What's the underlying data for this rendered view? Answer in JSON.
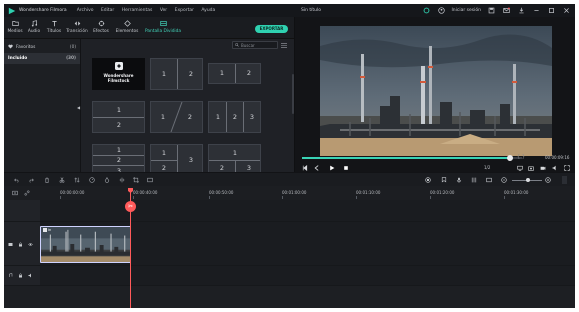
{
  "titlebar": {
    "app_name": "Wondershare Filmora",
    "menu": [
      "Archivo",
      "Editar",
      "Herramientas",
      "Ver",
      "Exportar",
      "Ayuda"
    ],
    "project_name": "Sin título",
    "login": "Iniciar sesión"
  },
  "toolbar": {
    "tabs": [
      {
        "label": "Medios",
        "icon": "folder-icon"
      },
      {
        "label": "Audio",
        "icon": "music-icon"
      },
      {
        "label": "Títulos",
        "icon": "text-icon"
      },
      {
        "label": "Transición",
        "icon": "transition-icon"
      },
      {
        "label": "Efectos",
        "icon": "effects-icon"
      },
      {
        "label": "Elementos",
        "icon": "elements-icon"
      },
      {
        "label": "Pantalla Dividida",
        "icon": "split-screen-icon",
        "active": true
      }
    ],
    "export_label": "EXPORTAR"
  },
  "library": {
    "items": [
      {
        "label": "Favoritos",
        "count": "(0)"
      },
      {
        "label": "Incluido",
        "count": "(30)",
        "selected": true
      }
    ]
  },
  "media": {
    "search_placeholder": "Buscar",
    "stock": {
      "line1": "Wondershare",
      "line2": "Filmstock"
    },
    "tiles": [
      {
        "numbers": [
          "1",
          "2"
        ]
      },
      {
        "numbers": [
          "1",
          "2"
        ]
      },
      {
        "numbers": [
          "1",
          "2"
        ]
      },
      {
        "numbers": [
          "1",
          "2"
        ]
      },
      {
        "numbers": [
          "1",
          "2",
          "3"
        ]
      },
      {
        "numbers": [
          "1",
          "2",
          "3"
        ]
      },
      {
        "numbers": [
          "1",
          "2",
          "3"
        ]
      },
      {
        "numbers": [
          "1",
          "2",
          "3"
        ]
      }
    ]
  },
  "preview": {
    "timecode": "00:00:09:16",
    "ratio": "1/2",
    "playback_progress": 0.945
  },
  "timeline": {
    "ruler_labels": [
      "00:00:00:00",
      "00:00:40:00",
      "00:00:50:00",
      "00:01:00:00",
      "00:01:10:00",
      "00:01:20:00",
      "00:01:30:00"
    ],
    "clip_label": "in"
  },
  "colors": {
    "accent": "#2fd1b0",
    "playhead": "#ff5a5a",
    "background": "#1f2126"
  }
}
